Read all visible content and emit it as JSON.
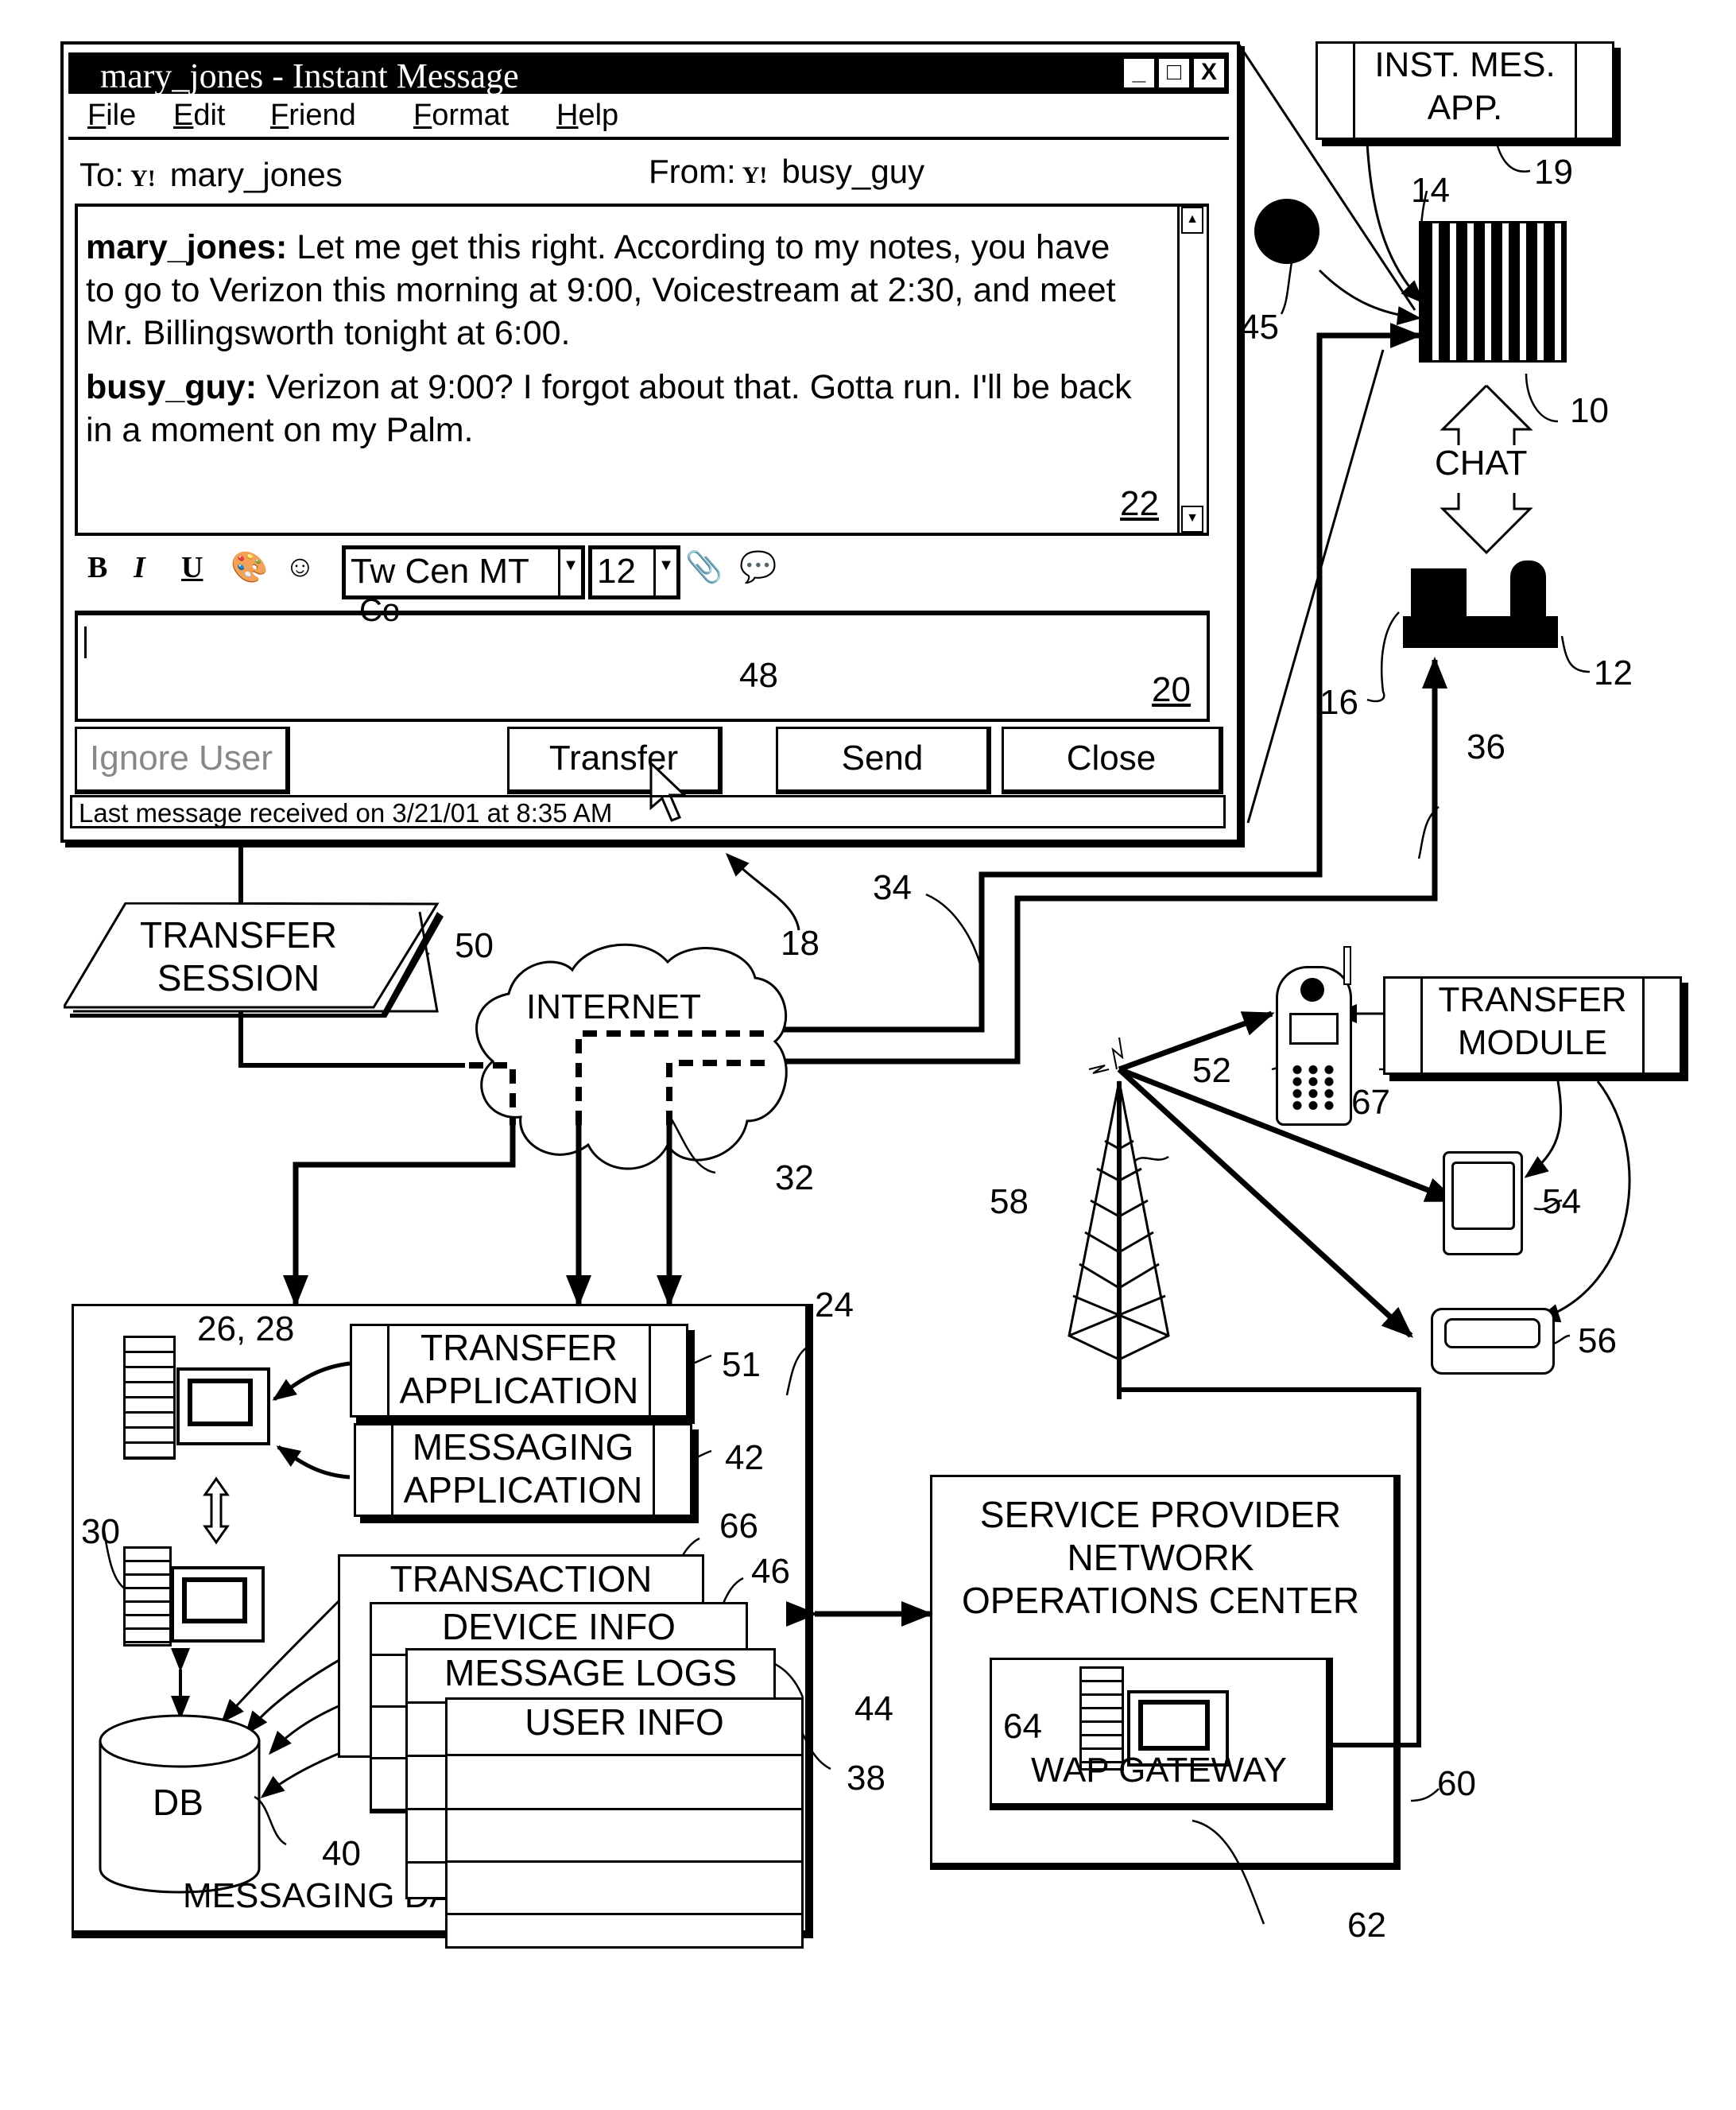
{
  "window": {
    "title": "mary_jones - Instant Message",
    "controls": {
      "minimize": "_",
      "maximize": "□",
      "close": "X"
    },
    "menu": [
      "File",
      "Edit",
      "Friend",
      "Format",
      "Help"
    ],
    "to_label": "To:",
    "to_user": "mary_jones",
    "from_label": "From:",
    "from_user": "busy_guy",
    "messenger_logo": "Y!",
    "history": [
      {
        "sender": "mary_jones:",
        "text": " Let me get this right.  According to my notes, you have to go to Verizon this morning at 9:00, Voicestream at 2:30, and meet Mr. Billingsworth tonight at 6:00."
      },
      {
        "sender": "busy_guy:",
        "text": "  Verizon at 9:00?  I forgot about that.  Gotta run.  I'll be back in a moment on my Palm."
      }
    ],
    "history_ref": "22",
    "toolbar": {
      "bold": "B",
      "italic": "I",
      "underline": "U",
      "icons": [
        "palette-icon",
        "smiley-icon",
        "attach-icon",
        "voice-chat-icon"
      ],
      "font_value": "Tw Cen MT",
      "size_value": "12",
      "stray_text": "Co"
    },
    "compose_value": "",
    "compose_ref": "20",
    "buttons": {
      "ignore": "Ignore User",
      "transfer": "Transfer",
      "send": "Send",
      "close": "Close"
    },
    "transfer_ref": "48",
    "status": "Last message received on 3/21/01 at 8:35 AM",
    "window_ref": "18"
  },
  "right_top": {
    "im_app": {
      "line1": "INST. MES.",
      "line2": "APP.",
      "ref": "19"
    },
    "refs": {
      "photo": "10",
      "photo_arrow": "14",
      "buddy_icon": "45",
      "desktop_user": "12",
      "desktop_line": "16"
    },
    "chat_label": "CHAT"
  },
  "links": {
    "internet_to_photo": "34",
    "internet_to_desktop": "36"
  },
  "transfer_session": {
    "line1": "TRANSFER",
    "line2": "SESSION",
    "ref": "50"
  },
  "internet": {
    "label": "INTERNET",
    "ref": "32"
  },
  "wireless": {
    "tower_ref": "58",
    "phone_ref": "52",
    "pda_ref": "54",
    "pager_ref": "56",
    "transfer_module": {
      "line1": "TRANSFER",
      "line2": "MODULE",
      "ref": "67"
    }
  },
  "data_center": {
    "label": "MESSAGING DATA CENTER",
    "ref": "24",
    "server_ref": "26, 28",
    "server2_ref": "30",
    "transfer_app": {
      "line1": "TRANSFER",
      "line2": "APPLICATION",
      "ref": "51"
    },
    "messaging_app": {
      "line1": "MESSAGING",
      "line2": "APPLICATION",
      "ref": "42"
    },
    "tables": [
      {
        "label": "TRANSACTION",
        "ref": "66"
      },
      {
        "label": "DEVICE INFO",
        "ref": "46"
      },
      {
        "label": "MESSAGE LOGS",
        "ref": "44"
      },
      {
        "label": "USER INFO",
        "ref": "38"
      }
    ],
    "db": {
      "label": "DB",
      "ref": "40"
    }
  },
  "noc": {
    "line1": "SERVICE PROVIDER",
    "line2": "NETWORK",
    "line3": "OPERATIONS CENTER",
    "ref": "60",
    "gateway": {
      "label": "WAP GATEWAY",
      "ref": "62",
      "server_ref": "64"
    }
  }
}
